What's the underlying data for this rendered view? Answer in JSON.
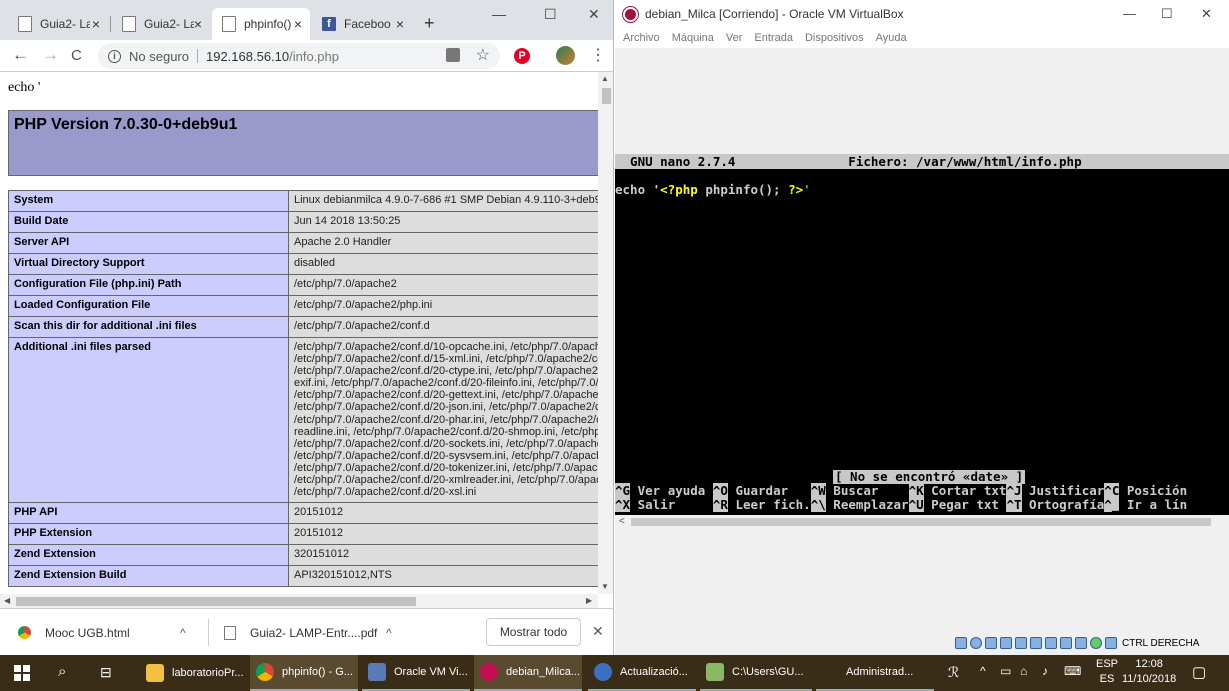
{
  "chrome": {
    "tabs": [
      {
        "label": "Guia2- La",
        "active": false
      },
      {
        "label": "Guia2- La",
        "active": false
      },
      {
        "label": "phpinfo()",
        "active": true
      },
      {
        "label": "Faceboo",
        "active": false
      }
    ],
    "new_tab": "+",
    "close_glyph": "×",
    "window_buttons": {
      "minimize": "—",
      "maximize": "☐",
      "close": "✕"
    },
    "nav": {
      "back": "←",
      "forward": "→",
      "reload": "C"
    },
    "address": {
      "security": "No seguro",
      "host": "192.168.56.10",
      "path": "/info.php"
    },
    "toolbar_icons": [
      "translate-icon",
      "star-icon",
      "pinterest-icon",
      "avatar-icon",
      "menu-icon"
    ]
  },
  "page": {
    "echo_text": "echo '",
    "php_version": "PHP Version 7.0.30-0+deb9u1",
    "rows": [
      {
        "key": "System",
        "value": [
          "Linux debianmilca 4.9.0-7-686 #1 SMP Debian 4.9.110-3+deb9u"
        ]
      },
      {
        "key": "Build Date",
        "value": [
          "Jun 14 2018 13:50:25"
        ]
      },
      {
        "key": "Server API",
        "value": [
          "Apache 2.0 Handler"
        ]
      },
      {
        "key": "Virtual Directory Support",
        "value": [
          "disabled"
        ]
      },
      {
        "key": "Configuration File (php.ini) Path",
        "value": [
          "/etc/php/7.0/apache2"
        ]
      },
      {
        "key": "Loaded Configuration File",
        "value": [
          "/etc/php/7.0/apache2/php.ini"
        ]
      },
      {
        "key": "Scan this dir for additional .ini files",
        "value": [
          "/etc/php/7.0/apache2/conf.d"
        ]
      },
      {
        "key": "Additional .ini files parsed",
        "value": [
          "/etc/php/7.0/apache2/conf.d/10-opcache.ini, /etc/php/7.0/apache",
          "/etc/php/7.0/apache2/conf.d/15-xml.ini, /etc/php/7.0/apache2/co",
          "/etc/php/7.0/apache2/conf.d/20-ctype.ini, /etc/php/7.0/apache2/c",
          "exif.ini, /etc/php/7.0/apache2/conf.d/20-fileinfo.ini, /etc/php/7.0/a",
          "/etc/php/7.0/apache2/conf.d/20-gettext.ini, /etc/php/7.0/apache2",
          "/etc/php/7.0/apache2/conf.d/20-json.ini, /etc/php/7.0/apache2/co",
          "/etc/php/7.0/apache2/conf.d/20-phar.ini, /etc/php/7.0/apache2/co",
          "readline.ini, /etc/php/7.0/apache2/conf.d/20-shmop.ini, /etc/php/",
          "/etc/php/7.0/apache2/conf.d/20-sockets.ini, /etc/php/7.0/apache2",
          "/etc/php/7.0/apache2/conf.d/20-sysvsem.ini, /etc/php/7.0/apache",
          "/etc/php/7.0/apache2/conf.d/20-tokenizer.ini, /etc/php/7.0/apache",
          "/etc/php/7.0/apache2/conf.d/20-xmlreader.ini, /etc/php/7.0/apach",
          "/etc/php/7.0/apache2/conf.d/20-xsl.ini"
        ]
      },
      {
        "key": "PHP API",
        "value": [
          "20151012"
        ]
      },
      {
        "key": "PHP Extension",
        "value": [
          "20151012"
        ]
      },
      {
        "key": "Zend Extension",
        "value": [
          "320151012"
        ]
      },
      {
        "key": "Zend Extension Build",
        "value": [
          "API320151012,NTS"
        ]
      }
    ]
  },
  "downloads": {
    "items": [
      {
        "name": "Mooc UGB.html",
        "chevron": "^"
      },
      {
        "name": "Guia2- LAMP-Entr....pdf",
        "chevron": "^"
      }
    ],
    "show_all": "Mostrar todo",
    "close": "✕"
  },
  "vbox": {
    "title": "debian_Milca [Corriendo] - Oracle VM VirtualBox",
    "menu": [
      "Archivo",
      "Máquina",
      "Ver",
      "Entrada",
      "Dispositivos",
      "Ayuda"
    ],
    "window_buttons": {
      "minimize": "—",
      "maximize": "☐",
      "close": "✕"
    },
    "nano": {
      "header": "  GNU nano 2.7.4               Fichero: /var/www/html/info.php",
      "line_prefix": "echo '",
      "line_php": "<?php",
      "line_mid": " phpinfo(); ",
      "line_end": "?>",
      "line_tail": "'",
      "status": "[ No se encontró «date» ]",
      "shortcuts_row1": [
        {
          "key": "^G",
          "label": " Ver ayuda "
        },
        {
          "key": "^O",
          "label": " Guardar   "
        },
        {
          "key": "^W",
          "label": " Buscar    "
        },
        {
          "key": "^K",
          "label": " Cortar txt"
        },
        {
          "key": "^J",
          "label": " Justificar"
        },
        {
          "key": "^C",
          "label": " Posición"
        }
      ],
      "shortcuts_row2": [
        {
          "key": "^X",
          "label": " Salir     "
        },
        {
          "key": "^R",
          "label": " Leer fich."
        },
        {
          "key": "^\\",
          "label": " Reemplazar"
        },
        {
          "key": "^U",
          "label": " Pegar txt "
        },
        {
          "key": "^T",
          "label": " Ortografía"
        },
        {
          "key": "^_",
          "label": " Ir a lín"
        }
      ]
    },
    "status_label": "CTRL DERECHA",
    "status_icons": [
      "hdd-icon",
      "optical-icon",
      "audio-icon",
      "network-icon",
      "usb-icon",
      "shared-folder-icon",
      "display-icon",
      "recording-icon",
      "cpu-icon",
      "mouse-icon",
      "keyboard-icon"
    ]
  },
  "taskbar": {
    "items": [
      {
        "label": "laboratorioPr..."
      },
      {
        "label": "phpinfo() - G..."
      },
      {
        "label": "Oracle VM Vi..."
      },
      {
        "label": "debian_Milca..."
      },
      {
        "label": "Actualizació..."
      },
      {
        "label": "C:\\Users\\GU..."
      },
      {
        "label": "Administrad..."
      }
    ],
    "lang_top": "ESP",
    "lang_bottom": "ES",
    "time": "12:08",
    "date": "11/10/2018"
  }
}
